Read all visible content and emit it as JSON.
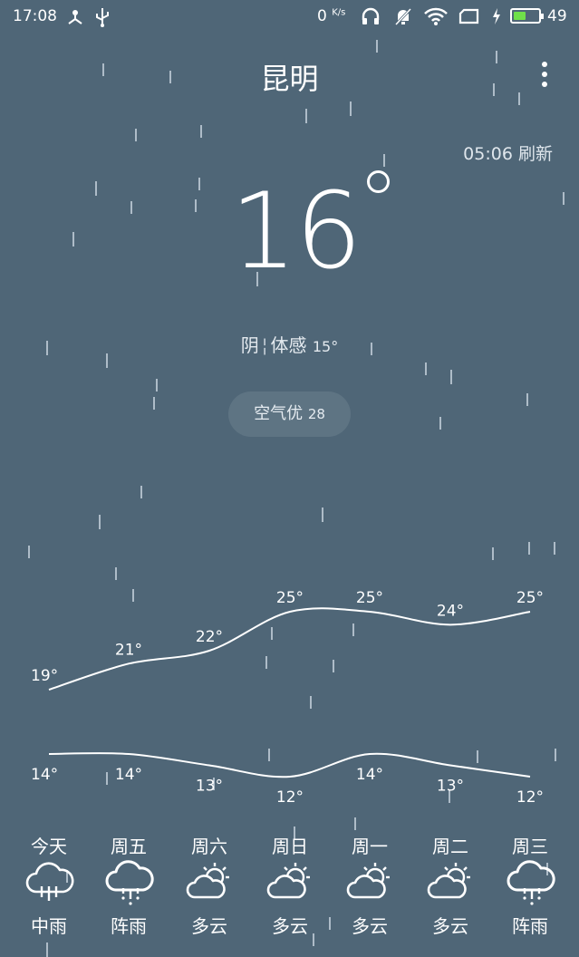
{
  "status_bar": {
    "time": "17:08",
    "network_speed": "0",
    "network_unit": "K/s",
    "battery_percent": "49",
    "battery_level": 0.49,
    "icons": [
      "fork-icon",
      "usb-icon",
      "headphones-icon",
      "muted-bell-icon",
      "wifi-icon",
      "sim-icon",
      "charging-icon",
      "battery-icon"
    ]
  },
  "header": {
    "city": "昆明",
    "refresh_time": "05:06",
    "refresh_label": "刷新"
  },
  "current": {
    "temperature": "16",
    "condition": "阴",
    "feels_like_label": "体感",
    "feels_like": "15°",
    "air_quality_label": "空气优",
    "air_quality_value": "28"
  },
  "colors": {
    "background": "#4f6677",
    "battery": "#6fe04a"
  },
  "chart_data": {
    "type": "line",
    "categories": [
      "今天",
      "周五",
      "周六",
      "周日",
      "周一",
      "周二",
      "周三"
    ],
    "series": [
      {
        "values": [
          19,
          21,
          22,
          25,
          25,
          24,
          25
        ]
      },
      {
        "values": [
          14,
          14,
          13,
          12,
          14,
          13,
          12
        ]
      }
    ],
    "high_labels": [
      "19°",
      "21°",
      "22°",
      "25°",
      "25°",
      "24°",
      "25°"
    ],
    "low_labels": [
      "14°",
      "14°",
      "13°",
      "12°",
      "14°",
      "13°",
      "12°"
    ]
  },
  "forecast": [
    {
      "day": "今天",
      "condition": "中雨",
      "icon": "rain-cloud-icon"
    },
    {
      "day": "周五",
      "condition": "阵雨",
      "icon": "shower-cloud-icon"
    },
    {
      "day": "周六",
      "condition": "多云",
      "icon": "partly-cloudy-icon"
    },
    {
      "day": "周日",
      "condition": "多云",
      "icon": "partly-cloudy-icon"
    },
    {
      "day": "周一",
      "condition": "多云",
      "icon": "partly-cloudy-icon"
    },
    {
      "day": "周二",
      "condition": "多云",
      "icon": "partly-cloudy-icon"
    },
    {
      "day": "周三",
      "condition": "阵雨",
      "icon": "shower-cloud-icon"
    }
  ]
}
